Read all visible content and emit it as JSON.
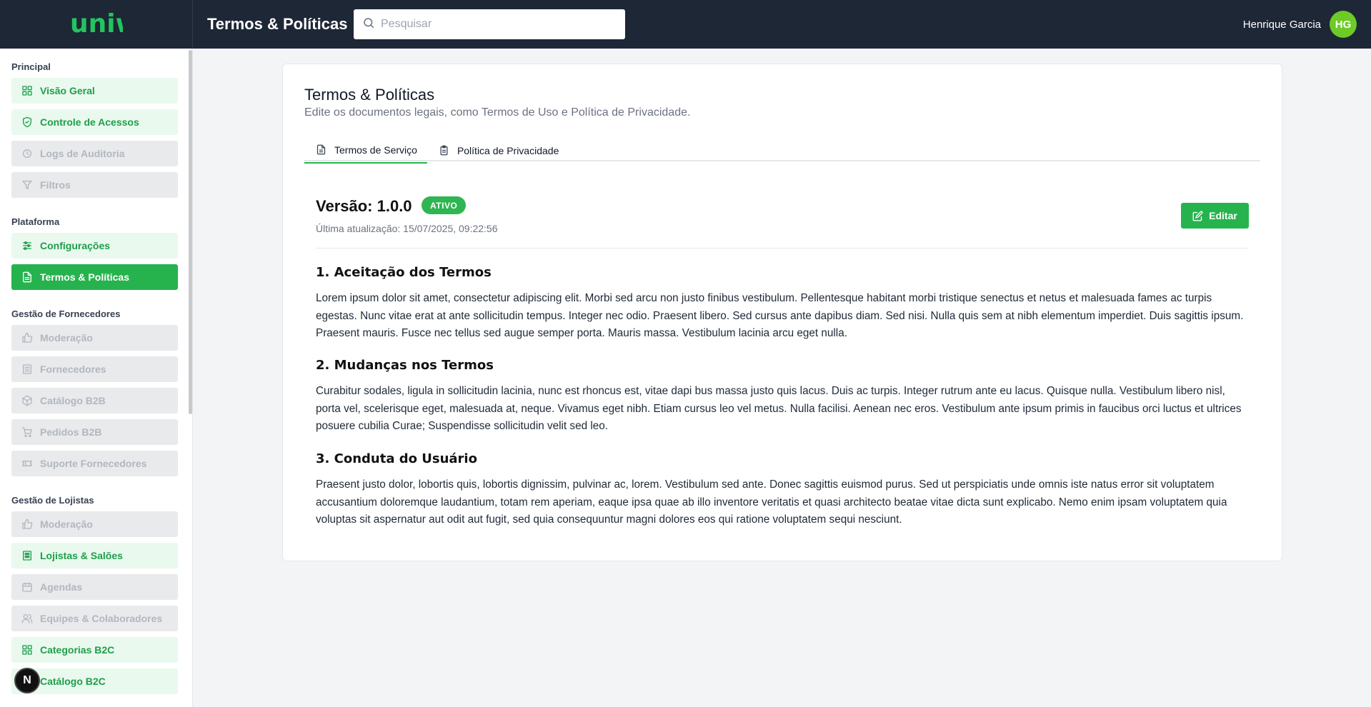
{
  "header": {
    "logo_text": "uniw",
    "title": "Termos & Políticas",
    "search_placeholder": "Pesquisar",
    "user_name": "Henrique Garcia",
    "user_initials": "HG"
  },
  "sidebar": {
    "sections": [
      {
        "title": "Principal",
        "items": [
          {
            "label": "Visão Geral",
            "state": "enabled",
            "icon": "grid-icon"
          },
          {
            "label": "Controle de Acessos",
            "state": "enabled",
            "icon": "shield-icon"
          },
          {
            "label": "Logs de Auditoria",
            "state": "disabled",
            "icon": "audit-icon"
          },
          {
            "label": "Filtros",
            "state": "disabled",
            "icon": "filter-icon"
          }
        ]
      },
      {
        "title": "Plataforma",
        "items": [
          {
            "label": "Configurações",
            "state": "enabled",
            "icon": "sliders-icon"
          },
          {
            "label": "Termos & Políticas",
            "state": "active",
            "icon": "document-icon"
          }
        ]
      },
      {
        "title": "Gestão de Fornecedores",
        "items": [
          {
            "label": "Moderação",
            "state": "disabled",
            "icon": "thumbs-up-icon"
          },
          {
            "label": "Fornecedores",
            "state": "disabled",
            "icon": "building-icon"
          },
          {
            "label": "Catálogo B2B",
            "state": "disabled",
            "icon": "box-icon"
          },
          {
            "label": "Pedidos B2B",
            "state": "disabled",
            "icon": "cart-icon"
          },
          {
            "label": "Suporte Fornecedores",
            "state": "disabled",
            "icon": "ticket-icon"
          }
        ]
      },
      {
        "title": "Gestão de Lojistas",
        "items": [
          {
            "label": "Moderação",
            "state": "disabled",
            "icon": "thumbs-up-icon"
          },
          {
            "label": "Lojistas & Salões",
            "state": "enabled",
            "icon": "store-icon"
          },
          {
            "label": "Agendas",
            "state": "disabled",
            "icon": "calendar-icon"
          },
          {
            "label": "Equipes & Colaboradores",
            "state": "disabled",
            "icon": "users-icon"
          },
          {
            "label": "Categorias B2C",
            "state": "enabled",
            "icon": "grid-icon"
          },
          {
            "label": "Catálogo B2C",
            "state": "enabled",
            "icon": "box-icon"
          }
        ]
      }
    ],
    "dev_badge": "N"
  },
  "card": {
    "title": "Termos & Políticas",
    "subtitle": "Edite os documentos legais, como Termos de Uso e Política de Privacidade.",
    "tabs": [
      {
        "label": "Termos de Serviço",
        "active": true
      },
      {
        "label": "Política de Privacidade",
        "active": false
      }
    ],
    "version_label": "Versão: 1.0.0",
    "status_badge": "ATIVO",
    "updated": "Última atualização: 15/07/2025, 09:22:56",
    "edit_label": "Editar",
    "sections": [
      {
        "title": "1. Aceitação dos Termos",
        "text": "Lorem ipsum dolor sit amet, consectetur adipiscing elit. Morbi sed arcu non justo finibus vestibulum. Pellentesque habitant morbi tristique senectus et netus et malesuada fames ac turpis egestas. Nunc vitae erat at ante sollicitudin tempus. Integer nec odio. Praesent libero. Sed cursus ante dapibus diam. Sed nisi. Nulla quis sem at nibh elementum imperdiet. Duis sagittis ipsum. Praesent mauris. Fusce nec tellus sed augue semper porta. Mauris massa. Vestibulum lacinia arcu eget nulla."
      },
      {
        "title": "2. Mudanças nos Termos",
        "text": "Curabitur sodales, ligula in sollicitudin lacinia, nunc est rhoncus est, vitae dapi bus massa justo quis lacus. Duis ac turpis. Integer rutrum ante eu lacus. Quisque nulla. Vestibulum libero nisl, porta vel, scelerisque eget, malesuada at, neque. Vivamus eget nibh. Etiam cursus leo vel metus. Nulla facilisi. Aenean nec eros. Vestibulum ante ipsum primis in faucibus orci luctus et ultrices posuere cubilia Curae; Suspendisse sollicitudin velit sed leo."
      },
      {
        "title": "3. Conduta do Usuário",
        "text": "Praesent justo dolor, lobortis quis, lobortis dignissim, pulvinar ac, lorem. Vestibulum sed ante. Donec sagittis euismod purus. Sed ut perspiciatis unde omnis iste natus error sit voluptatem accusantium doloremque laudantium, totam rem aperiam, eaque ipsa quae ab illo inventore veritatis et quasi architecto beatae vitae dicta sunt explicabo. Nemo enim ipsam voluptatem quia voluptas sit aspernatur aut odit aut fugit, sed quia consequuntur magni dolores eos qui ratione voluptatem sequi nesciunt."
      }
    ]
  }
}
